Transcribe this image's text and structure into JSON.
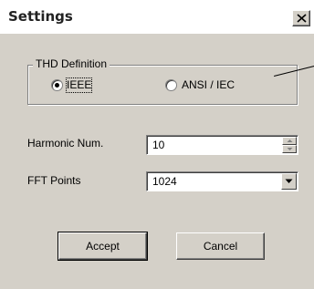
{
  "window": {
    "title": "Settings"
  },
  "thd_group": {
    "legend": "THD Definition",
    "options": [
      {
        "label": "IEEE",
        "selected": true
      },
      {
        "label": "ANSI / IEC",
        "selected": false
      }
    ]
  },
  "fields": {
    "harmonic_label": "Harmonic Num.",
    "harmonic_value": "10",
    "fft_label": "FFT Points",
    "fft_value": "1024"
  },
  "buttons": {
    "accept": "Accept",
    "cancel": "Cancel"
  },
  "icons": {
    "close": "close-icon",
    "spin_up": "up-arrow-icon",
    "spin_down": "down-arrow-icon",
    "dropdown": "chevron-down-icon"
  },
  "colors": {
    "face": "#d4d0c8",
    "field": "#ffffff",
    "shadow": "#808080",
    "text": "#000000"
  }
}
